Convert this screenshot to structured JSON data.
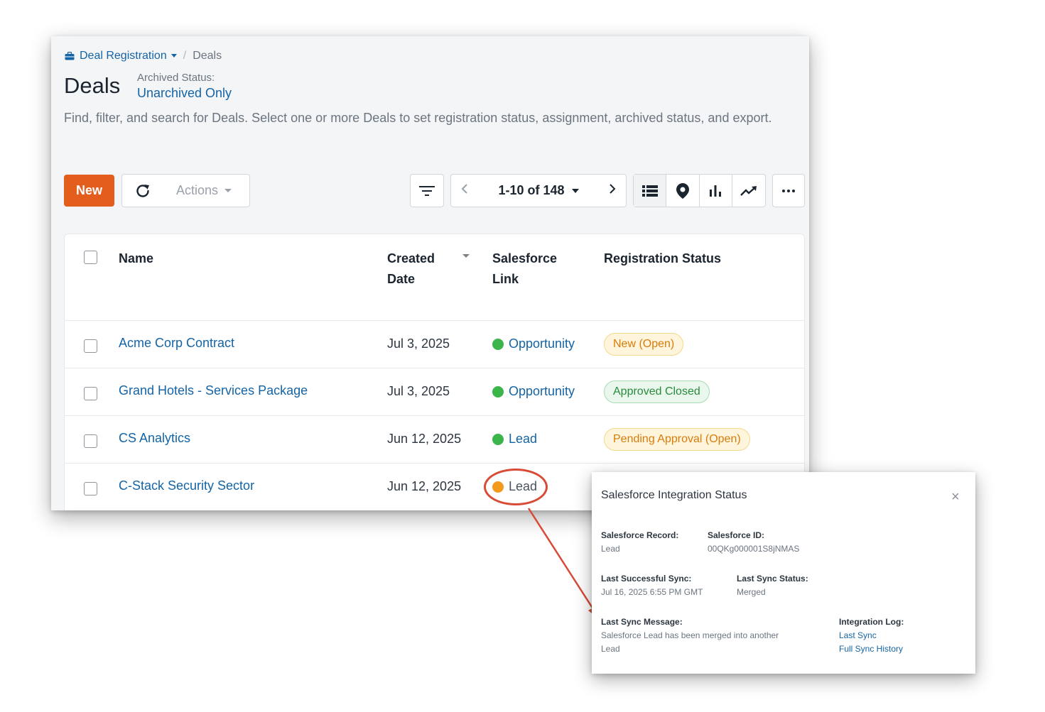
{
  "breadcrumb": {
    "root": "Deal Registration",
    "current": "Deals"
  },
  "page": {
    "title": "Deals",
    "archived_label": "Archived Status:",
    "archived_value": "Unarchived Only",
    "description": "Find, filter, and search for Deals. Select one or more Deals to set registration status, assignment, archived status, and export."
  },
  "toolbar": {
    "new_label": "New",
    "actions_label": "Actions",
    "pager_label": "1-10 of 148",
    "accent_color": "#e35d1d"
  },
  "table": {
    "headers": {
      "name": "Name",
      "created_line1": "Created",
      "created_line2": "Date",
      "sf_line1": "Salesforce",
      "sf_line2": "Link",
      "reg_status": "Registration Status"
    },
    "rows": [
      {
        "name": "Acme Corp Contract",
        "date": "Jul 3, 2025",
        "sf_link": "Opportunity",
        "sf_status": "green",
        "reg_status": "New (Open)",
        "reg_color": "orange"
      },
      {
        "name": "Grand Hotels - Services Package",
        "date": "Jul 3, 2025",
        "sf_link": "Opportunity",
        "sf_status": "green",
        "reg_status": "Approved Closed",
        "reg_color": "green"
      },
      {
        "name": "CS Analytics",
        "date": "Jun 12, 2025",
        "sf_link": "Lead",
        "sf_status": "green",
        "reg_status": "Pending Approval (Open)",
        "reg_color": "orange"
      },
      {
        "name": "C-Stack Security Sector",
        "date": "Jun 12, 2025",
        "sf_link": "Lead",
        "sf_status": "orange",
        "reg_status": "",
        "reg_color": ""
      }
    ]
  },
  "popup": {
    "title": "Salesforce Integration Status",
    "close": "×",
    "record_label": "Salesforce Record:",
    "record_value": "Lead",
    "id_label": "Salesforce ID:",
    "id_value": "00QKg000001S8jNMAS",
    "last_sync_label": "Last Successful Sync:",
    "last_sync_value": "Jul 16, 2025 6:55 PM GMT",
    "sync_status_label": "Last Sync Status:",
    "sync_status_value": "Merged",
    "message_label": "Last Sync Message:",
    "message_value_line1": "Salesforce Lead has been merged into another",
    "message_value_line2": "Lead",
    "log_label": "Integration Log:",
    "log_link1": "Last Sync",
    "log_link2": "Full Sync History"
  },
  "colors": {
    "link_blue": "#1464a5",
    "status_green": "#3bb44a",
    "status_orange": "#f39a1c",
    "annotation_red": "#d74b37"
  }
}
